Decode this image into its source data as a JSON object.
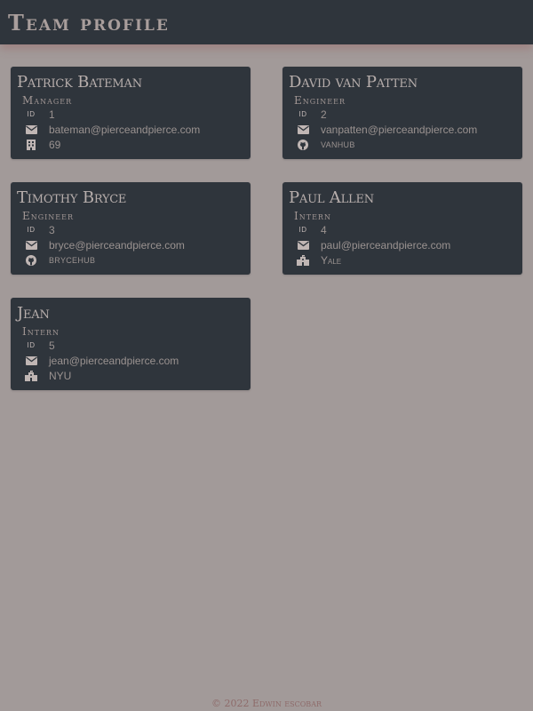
{
  "header": {
    "title": "Team profile"
  },
  "colors": {
    "background": "#a29a99",
    "card": "#2f353c",
    "text": "#a39c9b",
    "footer": "#8e6b6a"
  },
  "id_label": "ID",
  "members": [
    {
      "name": "Patrick Bateman",
      "role": "Manager",
      "id": "1",
      "email": "bateman@pierceandpierce.com",
      "extra": "69",
      "extra_icon": "building-icon",
      "extra_style": "plain"
    },
    {
      "name": "David van Patten",
      "role": "Engineer",
      "id": "2",
      "email": "vanpatten@pierceandpierce.com",
      "extra": "vanhub",
      "extra_icon": "github-icon",
      "extra_style": "upper"
    },
    {
      "name": "Timothy Bryce",
      "role": "Engineer",
      "id": "3",
      "email": "bryce@pierceandpierce.com",
      "extra": "brycehub",
      "extra_icon": "github-icon",
      "extra_style": "upper"
    },
    {
      "name": "Paul Allen",
      "role": "Intern",
      "id": "4",
      "email": "paul@pierceandpierce.com",
      "extra": "Yale",
      "extra_icon": "school-icon",
      "extra_style": "smallcaps"
    },
    {
      "name": "Jean",
      "role": "Intern",
      "id": "5",
      "email": "jean@pierceandpierce.com",
      "extra": "NYU",
      "extra_icon": "school-icon",
      "extra_style": "plain"
    }
  ],
  "footer": {
    "text": "© 2022 Edwin escobar"
  }
}
